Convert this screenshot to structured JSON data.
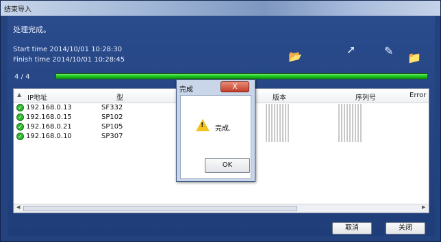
{
  "window": {
    "title": "结束导入"
  },
  "panel": {
    "status": "处理完成。",
    "start_time": "Start time 2014/10/01 10:28:30",
    "finish_time": "Finish time 2014/10/01 10:28:45",
    "progress_count": "4 / 4",
    "progress_fraction": 1.0
  },
  "toolbar": {
    "icons": [
      "open-folder-icon",
      "arrow-icon",
      "paint-icon",
      "export-icon"
    ]
  },
  "table": {
    "columns": [
      "IP地址",
      "型",
      "版本",
      "序列号",
      "Error"
    ],
    "rows": [
      {
        "ip": "192.168.0.13",
        "model": "SF332"
      },
      {
        "ip": "192.168.0.15",
        "model": "SP102"
      },
      {
        "ip": "192.168.0.21",
        "model": "SP105"
      },
      {
        "ip": "192.168.0.10",
        "model": "SP307"
      }
    ]
  },
  "buttons": {
    "cancel": "取消",
    "close": "关闭"
  },
  "dialog": {
    "title": "完成",
    "close": "X",
    "message": "完成.",
    "ok": "OK"
  },
  "colors": {
    "window_bg": "#24427e",
    "progress": "#1ec41e",
    "ok_status": "#2fb82f"
  }
}
